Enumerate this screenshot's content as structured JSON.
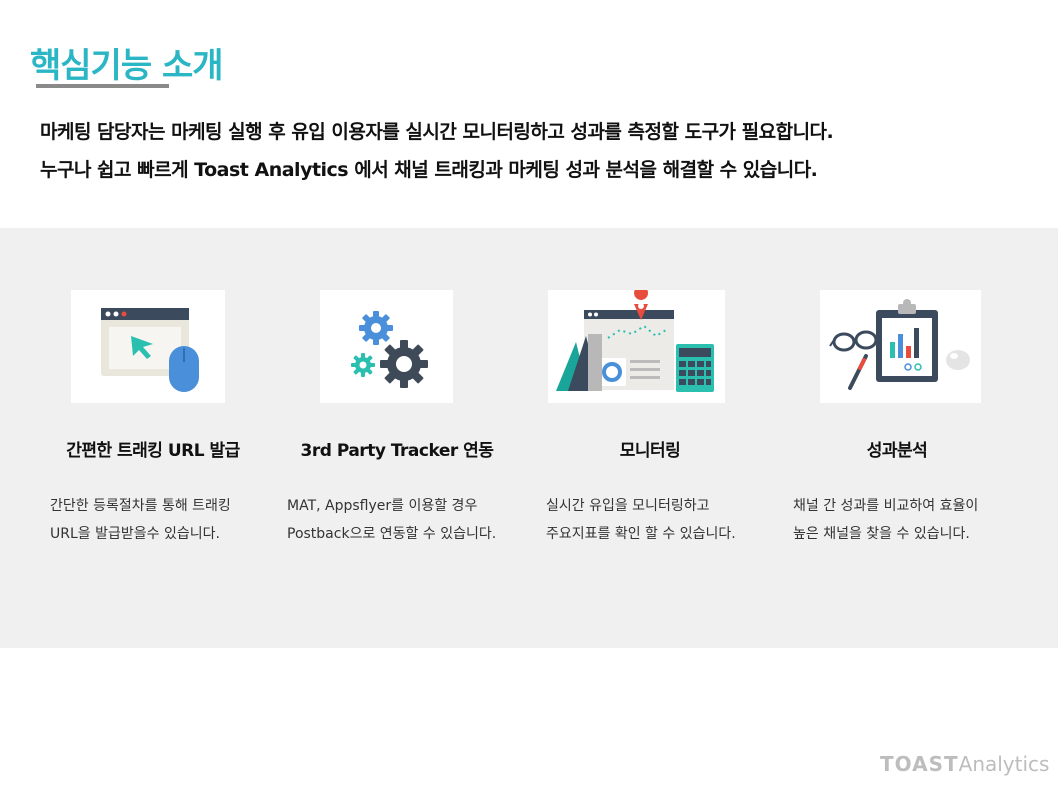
{
  "header": {
    "title": "핵심기능 소개",
    "intro_line1": "마케팅 담당자는 마케팅 실행 후 유입 이용자를 실시간 모니터링하고 성과를 측정할 도구가 필요합니다.",
    "intro_line2": "누구나 쉽고 빠르게 Toast Analytics 에서 채널 트래킹과 마케팅 성과 분석을 해결할 수 있습니다."
  },
  "features": [
    {
      "title": "간편한 트래킹 URL 발급",
      "desc_line1": "간단한 등록절차를 통해 트래킹",
      "desc_line2": "URL을 발급받을수 있습니다.",
      "icon": "browser-cursor-mouse-icon"
    },
    {
      "title": "3rd Party Tracker 연동",
      "desc_line1": "MAT, Appsflyer를 이용할 경우",
      "desc_line2": "Postback으로 연동할 수 있습니다.",
      "icon": "gears-icon"
    },
    {
      "title": "모니터링",
      "desc_line1": "실시간 유입을 모니터링하고",
      "desc_line2": "주요지표를 확인 할 수 있습니다.",
      "icon": "dashboard-map-pin-icon"
    },
    {
      "title": "성과분석",
      "desc_line1": "채널 간 성과를 비교하여 효율이",
      "desc_line2": "높은 채널을 찾을 수 있습니다.",
      "icon": "clipboard-report-icon"
    }
  ],
  "footer": {
    "logo_brand": "TOAST",
    "logo_product": "Analytics"
  },
  "colors": {
    "accent": "#2ab6c4",
    "band_bg": "#f0f0f0",
    "dark_slate": "#3b4a5c",
    "blue": "#4a8fd9",
    "teal": "#2bbfb0",
    "red": "#e84c3d"
  }
}
